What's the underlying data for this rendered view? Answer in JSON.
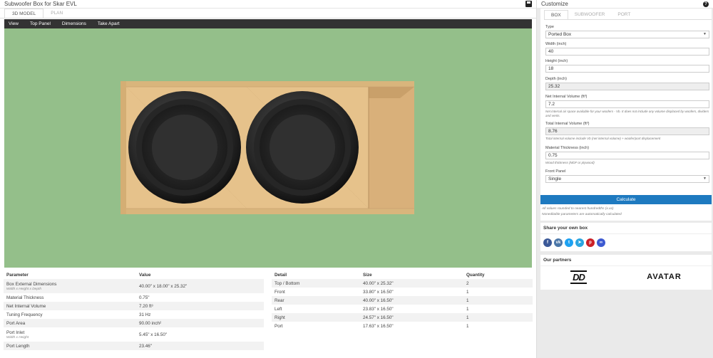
{
  "app": {
    "title": "Subwoofer Box for Skar EVL",
    "tabs": [
      "3D MODEL",
      "PLAN"
    ],
    "menu": [
      "View",
      "Top Panel",
      "Dimensions",
      "Take Apart"
    ]
  },
  "params_table": {
    "headers": [
      "Parameter",
      "Value"
    ],
    "rows": [
      {
        "name": "Box External Dimensions",
        "sub": "Width x Height x Depth",
        "value": "40.00\" x 18.00\" x 25.32\""
      },
      {
        "name": "Material Thickness",
        "sub": "",
        "value": "0.75\""
      },
      {
        "name": "Net Internal Volume",
        "sub": "",
        "value": "7.20 ft³"
      },
      {
        "name": "Tuning Frequency",
        "sub": "",
        "value": "31 Hz"
      },
      {
        "name": "Port Area",
        "sub": "",
        "value": "90.00 inch²"
      },
      {
        "name": "Port Inlet",
        "sub": "Width x Height",
        "value": "5.45\" x 16.50\""
      },
      {
        "name": "Port Length",
        "sub": "",
        "value": "23.46\""
      }
    ]
  },
  "detail_table": {
    "headers": [
      "Detail",
      "Size",
      "Quantity"
    ],
    "rows": [
      {
        "detail": "Top / Bottom",
        "size": "40.00\" x 25.32\"",
        "qty": "2"
      },
      {
        "detail": "Front",
        "size": "33.80\" x 16.50\"",
        "qty": "1"
      },
      {
        "detail": "Rear",
        "size": "40.00\" x 16.50\"",
        "qty": "1"
      },
      {
        "detail": "Left",
        "size": "23.83\" x 16.50\"",
        "qty": "1"
      },
      {
        "detail": "Right",
        "size": "24.57\" x 16.50\"",
        "qty": "1"
      },
      {
        "detail": "Port",
        "size": "17.63\" x 16.50\"",
        "qty": "1"
      }
    ]
  },
  "customize": {
    "title": "Customize",
    "tabs": [
      "BOX",
      "SUBWOOFER",
      "PORT"
    ],
    "type": {
      "label": "Type",
      "value": "Ported Box"
    },
    "width": {
      "label": "Width (inch)",
      "value": "40"
    },
    "height": {
      "label": "Height (inch)",
      "value": "18"
    },
    "depth": {
      "label": "Depth (inch)",
      "value": "25.32"
    },
    "net_volume": {
      "label": "Net Internal Volume (ft³)",
      "value": "7.2",
      "help": "Net internal air space available for your woofers - Vb. It does not include any volume displaced by woofers, dividers and vents."
    },
    "total_volume": {
      "label": "Total Internal Volume (ft³)",
      "value": "8.76",
      "help": "Total internal volume include Vb (net internal volume) + woofer/port displacement"
    },
    "thickness": {
      "label": "Material Thickness (inch)",
      "value": "0.75",
      "help": "Wood thickness (MDF or plywood)"
    },
    "front_panel": {
      "label": "Front Panel",
      "value": "Single"
    },
    "calculate": "Calculate",
    "note1": "All values rounded to nearest hundredths (x.xx)",
    "note2": "Noneditable parameters are automatically calculated"
  },
  "share": {
    "title": "Share your own box",
    "icons": [
      {
        "name": "facebook-icon",
        "glyph": "f",
        "color": "#3b5998"
      },
      {
        "name": "vk-icon",
        "glyph": "vk",
        "color": "#4a76a8"
      },
      {
        "name": "twitter-icon",
        "glyph": "t",
        "color": "#1da1f2"
      },
      {
        "name": "telegram-icon",
        "glyph": "➤",
        "color": "#2ca5e0"
      },
      {
        "name": "pinterest-icon",
        "glyph": "p",
        "color": "#cb2027"
      },
      {
        "name": "link-icon",
        "glyph": "∞",
        "color": "#3d5ad1"
      }
    ]
  },
  "partners": {
    "title": "Our partners",
    "logo1": "DD",
    "logo2": "AVATAR"
  }
}
